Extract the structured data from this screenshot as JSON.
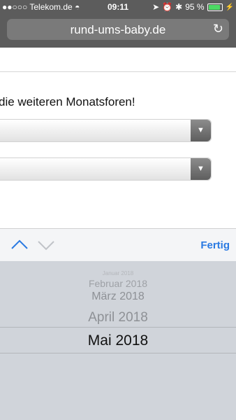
{
  "status_bar": {
    "carrier": "●●○○○ Telekom.de",
    "time": "09:11",
    "battery": "95 %",
    "battery_level": 0.95
  },
  "browser": {
    "url": "rund-ums-baby.de"
  },
  "page": {
    "text": "die weiteren Monatsforen!"
  },
  "toolbar": {
    "done_label": "Fertig"
  },
  "picker": {
    "items": [
      "Januar 2018",
      "Februar 2018",
      "März 2018",
      "April 2018",
      "Mai 2018"
    ],
    "selected": "Mai 2018"
  },
  "colors": {
    "browser_chrome": "#5c5c5c",
    "accent": "#2a7ae2",
    "picker_bg": "#d0d4da"
  }
}
